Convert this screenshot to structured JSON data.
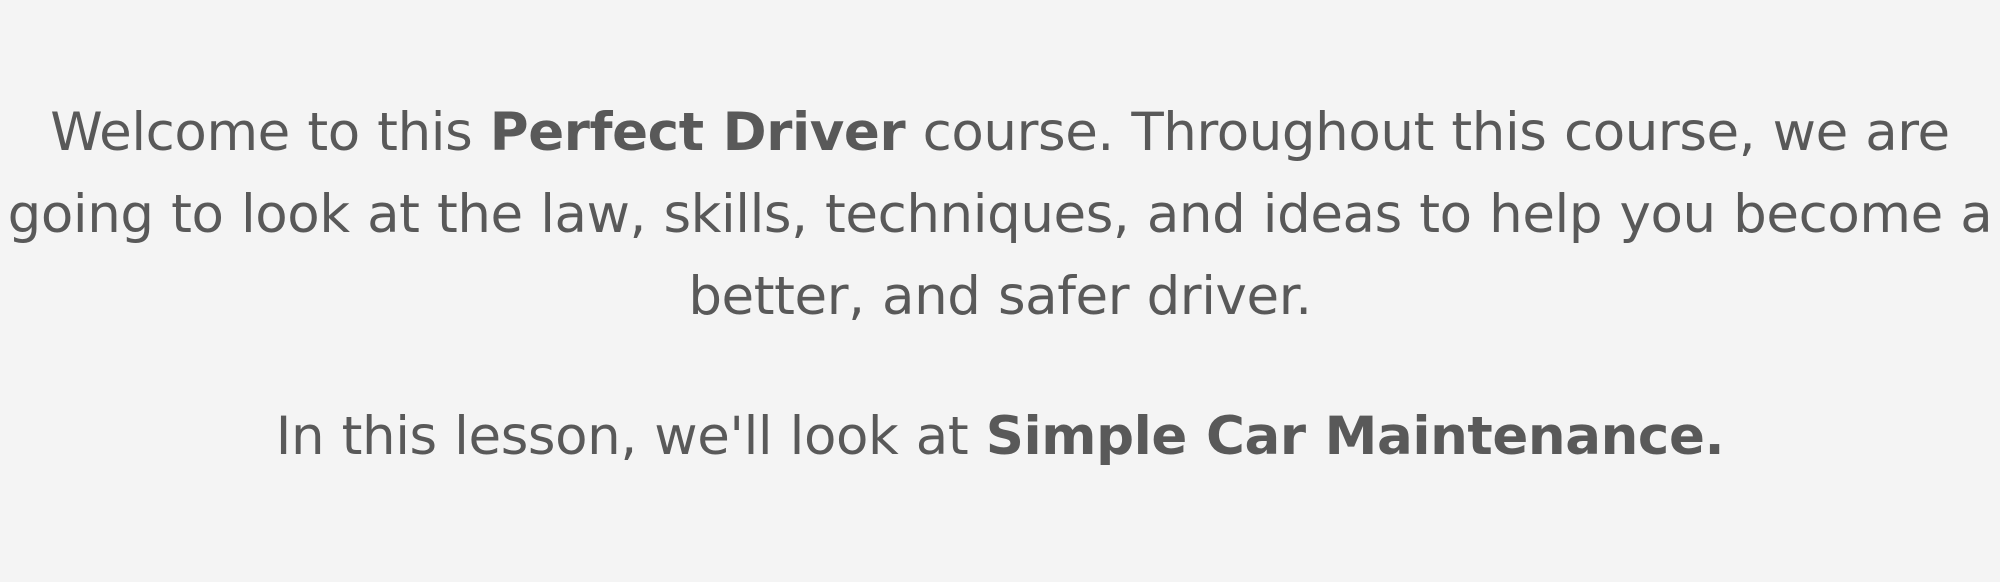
{
  "intro": {
    "line1_before": "Welcome to this ",
    "course_name": "Perfect Driver",
    "line1_after": " course. Throughout this course, we are",
    "line2": "going to look at the law, skills, techniques, and ideas to help you become a",
    "line3": "better, and safer driver."
  },
  "lesson": {
    "prefix": "In this lesson, we'll look at ",
    "topic": "Simple Car Maintenance."
  },
  "colors": {
    "background": "#f4f4f4",
    "text": "#595959"
  }
}
